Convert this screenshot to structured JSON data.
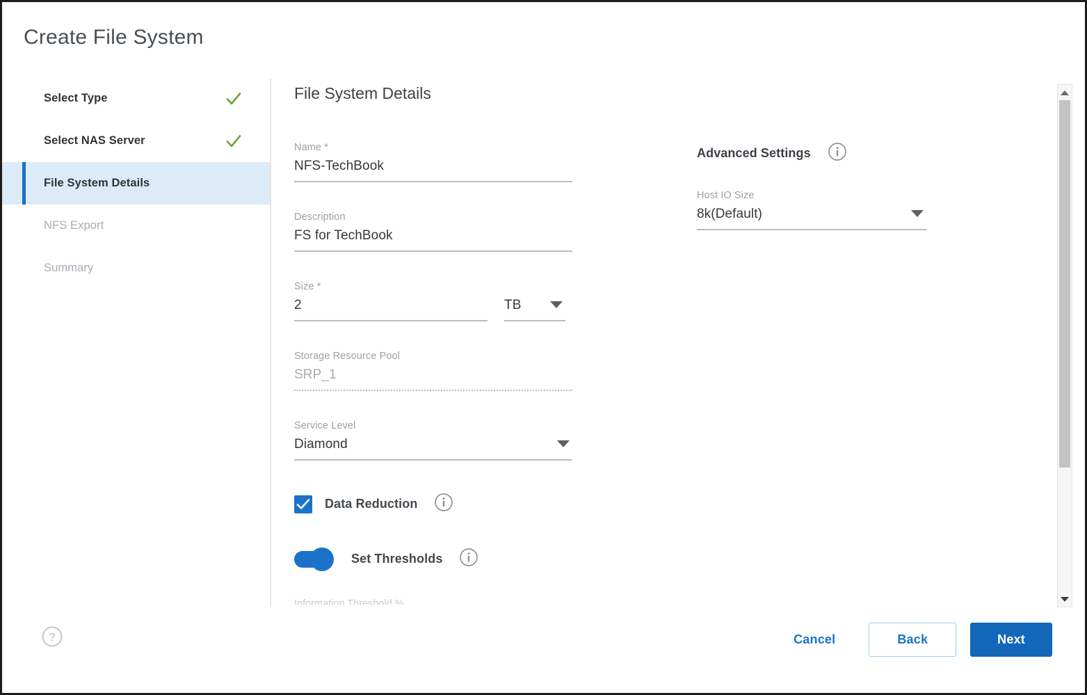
{
  "dialog": {
    "title": "Create File System"
  },
  "sidebar": {
    "steps": [
      {
        "label": "Select Type",
        "state": "done",
        "icon": "check-icon"
      },
      {
        "label": "Select NAS Server",
        "state": "done",
        "icon": "check-icon"
      },
      {
        "label": "File System Details",
        "state": "active",
        "icon": ""
      },
      {
        "label": "NFS Export",
        "state": "pending",
        "icon": ""
      },
      {
        "label": "Summary",
        "state": "pending",
        "icon": ""
      }
    ]
  },
  "main": {
    "section_title": "File System Details",
    "fields": {
      "name": {
        "label": "Name *",
        "value": "NFS-TechBook"
      },
      "description": {
        "label": "Description",
        "value": "FS for TechBook"
      },
      "size": {
        "label": "Size *",
        "value": "2",
        "unit": "TB"
      },
      "storage_resource_pool": {
        "label": "Storage Resource Pool",
        "value": "SRP_1"
      },
      "service_level": {
        "label": "Service Level",
        "value": "Diamond"
      }
    },
    "options": {
      "data_reduction": {
        "label": "Data Reduction",
        "checked": "true",
        "info": "info-icon"
      },
      "set_thresholds": {
        "label": "Set Thresholds",
        "enabled": "true",
        "info": "info-icon"
      },
      "clipped_label": "Information Threshold %"
    }
  },
  "advanced": {
    "title": "Advanced Settings",
    "info": "info-icon",
    "host_io_size": {
      "label": "Host IO Size",
      "value": "8k(Default)"
    }
  },
  "scrollbar": {
    "up": "chevron-up-icon",
    "down": "chevron-down-icon"
  },
  "footer": {
    "help": "help-icon",
    "cancel_label": "Cancel",
    "back_label": "Back",
    "next_label": "Next"
  },
  "colors": {
    "accent": "#1a73c8",
    "primary_button": "#1267b8",
    "active_step_bg": "#dcebf7",
    "active_step_bar": "#1a6fc4",
    "check_green": "#6aa534",
    "muted_text": "#9aa0a6"
  }
}
